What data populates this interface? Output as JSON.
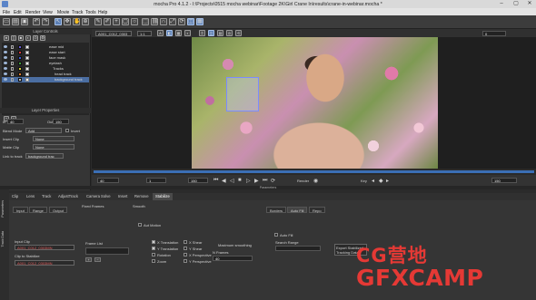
{
  "window": {
    "title": "mocha Pro 4.1.2 - I:\\Projects\\0515 mocha webinar\\Footage 2K\\Girl Crane In\\results\\crane-in-webinar.mocha *"
  },
  "menu": [
    "File",
    "Edit",
    "Render",
    "View",
    "Movie",
    "Track",
    "Tools",
    "Help"
  ],
  "layer_controls": {
    "header": "Layer Controls",
    "layers": [
      {
        "name": "ease mid",
        "color": "#6b5ad6",
        "selected": false
      },
      {
        "name": "ease start",
        "color": "#d23b3b",
        "selected": false
      },
      {
        "name": "face mask",
        "color": "#3a57d6",
        "selected": false
      },
      {
        "name": "eyelash",
        "color": "#3c9b3c",
        "selected": false
      },
      {
        "name": "Tracks",
        "color": "#d1cd3a",
        "selected": false
      },
      {
        "name": "head track",
        "color": "#e07b2a",
        "selected": false
      },
      {
        "name": "background track",
        "color": "#bfbfbf",
        "selected": true
      }
    ]
  },
  "layer_properties": {
    "header": "Layer Properties",
    "in_label": "In",
    "in_value": "40",
    "out_label": "Out",
    "out_value": "150",
    "blend_mode_label": "Blend Mode",
    "blend_mode_value": "Add",
    "invert_label": "Invert",
    "insert_clip_label": "Insert Clip",
    "insert_clip_value": "None",
    "matte_clip_label": "Matte Clip",
    "matte_clip_value": "None",
    "link_label": "Link to track",
    "link_value": "background trac"
  },
  "viewer_bar": {
    "clip_name": "A001_C012_0303",
    "zoom": "1:1",
    "frame": "0"
  },
  "transport": {
    "start": "40",
    "current_a": "1",
    "current_b": "150",
    "end": "150",
    "render_label": "Render",
    "key_label": "Key",
    "params_label": "Parameters"
  },
  "tabs": [
    "Clip",
    "Lens",
    "Track",
    "AdjustTrack",
    "Camera Solve",
    "Insert",
    "Remove",
    "Stabilize"
  ],
  "active_tab": "Stabilize",
  "side_tabs": [
    "Parameters",
    "Track Data"
  ],
  "stabilize": {
    "subtabs": [
      "Input",
      "Range",
      "Output"
    ],
    "fixed_frames_label": "Fixed Frames",
    "smooth_label": "Smooth",
    "auto_motion_label": "Aut Motion",
    "input_clip_label": "Input Clip",
    "input_clip_value": "A001_C012_0303MN",
    "clip_to_stabilize_label": "Clip to Stabilize",
    "clip_to_stabilize_value": "A001_C012_0303MN",
    "frame_list_label": "Frame List",
    "x_translation": "X Translation",
    "y_translation": "Y Translation",
    "rotation": "Rotation",
    "zoom": "Zoom",
    "x_shear": "X Shear",
    "y_shear": "Y Shear",
    "x_perspective": "X Perspective",
    "y_perspective": "Y Perspective",
    "max_smoothing_label": "Maximum smoothing",
    "n_frames_label": "N Frames",
    "n_frames_value": "40",
    "right_tabs": [
      "Borders",
      "Auto Fill",
      "Repo"
    ],
    "auto_fill_label": "Auto Fill",
    "search_range_label": "Search Range",
    "export_label": "Export Stabilized",
    "tracking_data_label": "Tracking Data"
  },
  "watermark": {
    "line1": "CG营地",
    "line2": "GFXCAMP"
  },
  "colors": {
    "accent": "#4b6ea2",
    "track_box": "#7c8cff",
    "timeline": "#3b6fb5",
    "watermark_red": "#e53935"
  }
}
